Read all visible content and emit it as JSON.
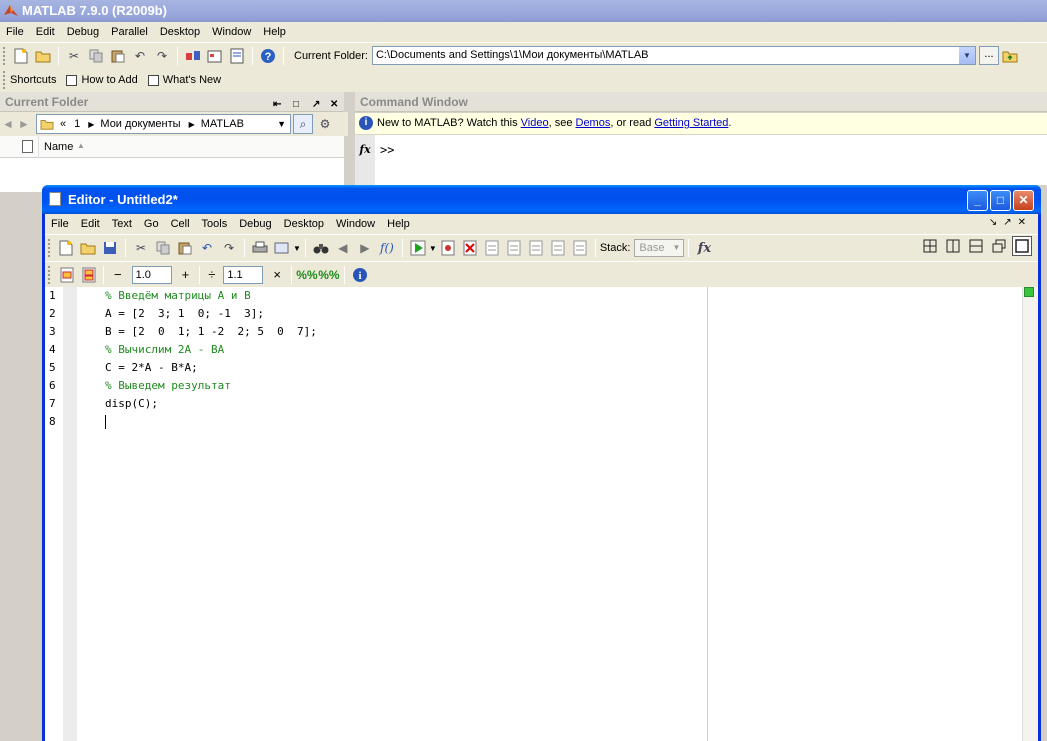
{
  "main": {
    "title": "MATLAB  7.9.0 (R2009b)",
    "menu": [
      "File",
      "Edit",
      "Debug",
      "Parallel",
      "Desktop",
      "Window",
      "Help"
    ],
    "current_folder_label": "Current Folder:",
    "current_folder_path": "C:\\Documents and Settings\\1\\Мои документы\\MATLAB",
    "browse_label": "...",
    "shortcuts": [
      "Shortcuts",
      "How to Add",
      "What's New"
    ]
  },
  "current_folder_panel": {
    "title": "Current Folder",
    "path_parts": [
      "«",
      "1",
      "Мои документы",
      "MATLAB"
    ],
    "column_name": "Name"
  },
  "command_window": {
    "title": "Command Window",
    "info_prefix": "New to MATLAB? Watch this ",
    "info_link_video": "Video",
    "info_mid": ", see ",
    "info_link_demos": "Demos",
    "info_mid2": ", or read ",
    "info_link_started": "Getting Started",
    "info_suffix": ".",
    "fx": "fx",
    "prompt": ">>"
  },
  "editor": {
    "title": "Editor - Untitled2*",
    "menu": [
      "File",
      "Edit",
      "Text",
      "Go",
      "Cell",
      "Tools",
      "Debug",
      "Desktop",
      "Window",
      "Help"
    ],
    "stack_label": "Stack:",
    "stack_value": "Base",
    "cell_minus": "−",
    "cell_value_1": "1.0",
    "cell_plus": "+",
    "cell_div": "÷",
    "cell_value_2": "1.1",
    "cell_times": "×",
    "lines": [
      {
        "num": "1",
        "text": "% Введём матрицы A и B",
        "comment": true
      },
      {
        "num": "2",
        "text": "A = [2  3; 1  0; -1  3];",
        "comment": false
      },
      {
        "num": "3",
        "text": "B = [2  0  1; 1 -2  2; 5  0  7];",
        "comment": false
      },
      {
        "num": "4",
        "text": "% Вычислим 2A - BA",
        "comment": true
      },
      {
        "num": "5",
        "text": "C = 2*A - B*A;",
        "comment": false
      },
      {
        "num": "6",
        "text": "% Выведем результат",
        "comment": true
      },
      {
        "num": "7",
        "text": "disp(C);",
        "comment": false
      },
      {
        "num": "8",
        "text": "",
        "comment": false
      }
    ]
  },
  "colors": {
    "xp_blue_title": "#0053ee",
    "comment_green": "#228b22",
    "status_ok": "#3cc43c"
  }
}
